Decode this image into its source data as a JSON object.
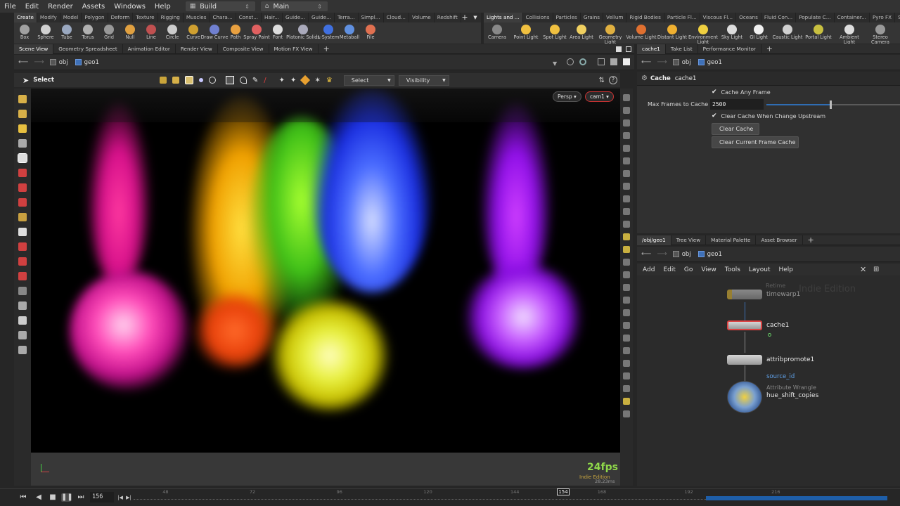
{
  "menu": {
    "items": [
      "File",
      "Edit",
      "Render",
      "Assets",
      "Windows",
      "Help"
    ],
    "desktop": "Build",
    "desktop_glyph": "▦",
    "main": "Main",
    "main_glyph": "⌂"
  },
  "shelf": {
    "left_tabs": [
      "Create",
      "Modify",
      "Model",
      "Polygon",
      "Deform",
      "Texture",
      "Rigging",
      "Muscles",
      "Chara...",
      "Const...",
      "Hair...",
      "Guide...",
      "Guide...",
      "Terra...",
      "Simpl...",
      "Cloud...",
      "Volume",
      "Redshift"
    ],
    "right_tabs": [
      "Lights and ...",
      "Collisions",
      "Particles",
      "Grains",
      "Vellum",
      "Rigid Bodies",
      "Particle Fl...",
      "Viscous Fl...",
      "Oceans",
      "Fluid Con...",
      "Populate C...",
      "Container...",
      "Pyro FX",
      "Spar"
    ],
    "left_tools": [
      "Box",
      "Sphere",
      "Tube",
      "Torus",
      "Grid",
      "Null",
      "Line",
      "Circle",
      "Curve",
      "Draw Curve",
      "Path",
      "Spray Paint",
      "Font",
      "Platonic Solids",
      "L-System",
      "Metaball",
      "File"
    ],
    "right_tools": [
      "Camera",
      "Point Light",
      "Spot Light",
      "Area Light",
      "Geometry Light",
      "Volume Light",
      "Distant Light",
      "Environment Light",
      "Sky Light",
      "GI Light",
      "Caustic Light",
      "Portal Light",
      "Ambient Light",
      "Stereo Camera"
    ]
  },
  "left_pane": {
    "tabs": [
      "Scene View",
      "Geometry Spreadsheet",
      "Animation Editor",
      "Render View",
      "Composite View",
      "Motion FX View"
    ],
    "path": [
      "obj",
      "geo1"
    ]
  },
  "viewport": {
    "tool": "Select",
    "select_dropdown": "Select",
    "visibility_dropdown": "Visibility",
    "persp": "Persp ▾",
    "cam": "cam1 ▾",
    "fps": "24fps",
    "ms": "28.23ms",
    "edition": "Indie Edition"
  },
  "timeline": {
    "frame": "156",
    "ticks": [
      "48",
      "72",
      "96",
      "120",
      "144",
      "168",
      "192",
      "216"
    ],
    "current_marker": "154"
  },
  "params": {
    "tabs": [
      "cache1",
      "Take List",
      "Performance Monitor"
    ],
    "path": [
      "obj",
      "geo1"
    ],
    "node_type": "Cache",
    "node_name": "cache1",
    "cache_any_frame": "Cache Any Frame",
    "max_frames_label": "Max Frames to Cache",
    "max_frames_value": "2500",
    "clear_on_change": "Clear Cache When Change Upstream",
    "clear_cache_btn": "Clear Cache",
    "clear_current_btn": "Clear Current Frame Cache"
  },
  "network": {
    "tabs": [
      "/obj/geo1",
      "Tree View",
      "Material Palette",
      "Asset Browser"
    ],
    "path": [
      "obj",
      "geo1"
    ],
    "menu": [
      "Add",
      "Edit",
      "Go",
      "View",
      "Tools",
      "Layout",
      "Help"
    ],
    "watermark": "Indie Edition",
    "nodes": [
      {
        "type": "Retime",
        "name": "timewarp1"
      },
      {
        "name": "cache1"
      },
      {
        "name": "attribpromote1",
        "param": "source_id"
      },
      {
        "type": "Attribute Wrangle",
        "name": "hue_shift_copies"
      }
    ]
  },
  "colors": {
    "accent_blue": "#2f6db3",
    "timeline_range": "#1e5ea8",
    "node_flag": "#f0c437"
  }
}
